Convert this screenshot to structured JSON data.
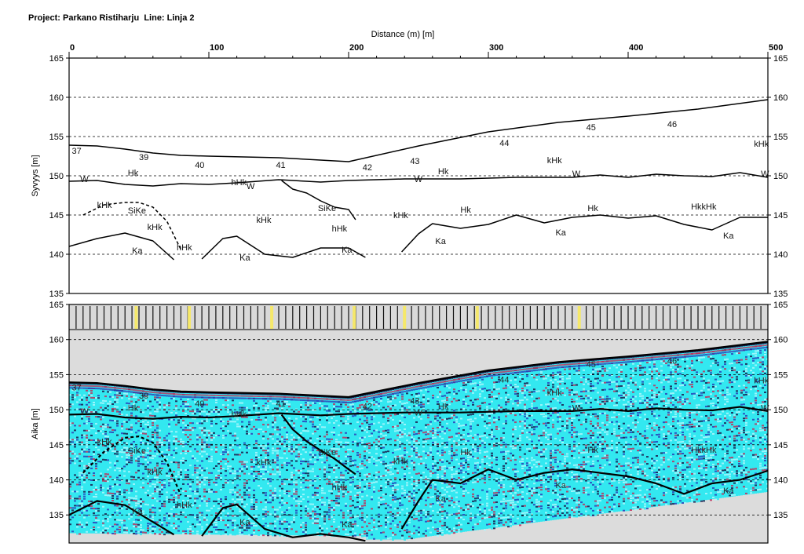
{
  "header": {
    "title": "Project: Parkano Ristiharju  Line: Linja 2"
  },
  "chart_data": [
    {
      "type": "line",
      "panel": "interpretation",
      "xlabel": "Distance (m) [m]",
      "ylabel": "Syvyys [m]",
      "xlim": [
        0,
        500
      ],
      "ylim": [
        135,
        165
      ],
      "x_ticks": [
        0,
        100,
        200,
        300,
        400,
        500
      ],
      "y_ticks": [
        135,
        140,
        145,
        150,
        155,
        160,
        165
      ],
      "grid": "horizontal dashed",
      "series": [
        {
          "role": "surface",
          "x": [
            0,
            20,
            40,
            60,
            80,
            100,
            150,
            200,
            250,
            300,
            350,
            400,
            450,
            500
          ],
          "values": [
            153.9,
            153.8,
            153.4,
            152.9,
            152.6,
            152.5,
            152.3,
            151.8,
            153.8,
            155.6,
            156.8,
            157.6,
            158.5,
            159.7
          ]
        },
        {
          "role": "water-table",
          "x": [
            0,
            20,
            40,
            60,
            80,
            100,
            120,
            150,
            180,
            200,
            240,
            280,
            320,
            360,
            380,
            400,
            420,
            440,
            460,
            480,
            500
          ],
          "values": [
            149.3,
            149.4,
            148.9,
            148.7,
            149.0,
            148.9,
            149.1,
            149.5,
            149.2,
            149.4,
            149.6,
            149.6,
            149.8,
            149.8,
            150.1,
            149.8,
            150.2,
            150.0,
            149.9,
            150.4,
            149.8
          ]
        },
        {
          "role": "bedrock-1",
          "x": [
            0,
            20,
            40,
            60,
            75
          ],
          "values": [
            141.0,
            142.0,
            142.7,
            141.7,
            139.3
          ]
        },
        {
          "role": "bedrock-2",
          "x": [
            95,
            110,
            120,
            140,
            160,
            180,
            200,
            212
          ],
          "values": [
            139.4,
            142.0,
            142.3,
            140.0,
            139.6,
            140.8,
            140.8,
            139.6
          ]
        },
        {
          "role": "bedrock-3",
          "x": [
            238,
            250,
            260,
            280,
            300,
            320,
            340,
            360,
            380,
            400,
            420,
            440,
            460,
            480,
            500
          ],
          "values": [
            140.3,
            142.6,
            143.9,
            143.3,
            143.8,
            145.0,
            144.0,
            144.7,
            145.0,
            144.6,
            144.9,
            143.8,
            143.1,
            144.7,
            144.7
          ]
        },
        {
          "role": "siltkey-1",
          "dashed": true,
          "x": [
            10,
            25,
            40,
            50,
            60,
            70,
            80
          ],
          "values": [
            145.0,
            146.3,
            146.6,
            146.6,
            146.0,
            144.2,
            140.6
          ]
        },
        {
          "role": "siltkey-2",
          "x": [
            152,
            160,
            170,
            180,
            190,
            200,
            205
          ],
          "values": [
            149.4,
            148.3,
            147.8,
            146.8,
            146.0,
            145.7,
            144.4
          ]
        }
      ],
      "annotations": [
        {
          "text": "37",
          "x": 2,
          "y": 153.2
        },
        {
          "text": "39",
          "x": 50,
          "y": 152.4
        },
        {
          "text": "40",
          "x": 90,
          "y": 151.4
        },
        {
          "text": "41",
          "x": 148,
          "y": 151.4
        },
        {
          "text": "42",
          "x": 210,
          "y": 151.1
        },
        {
          "text": "43",
          "x": 244,
          "y": 151.9
        },
        {
          "text": "44",
          "x": 308,
          "y": 154.2
        },
        {
          "text": "45",
          "x": 370,
          "y": 156.2
        },
        {
          "text": "46",
          "x": 428,
          "y": 156.6
        },
        {
          "text": "kHk",
          "x": 490,
          "y": 154.1
        },
        {
          "text": "W",
          "x": 8,
          "y": 149.6
        },
        {
          "text": "Hk",
          "x": 42,
          "y": 150.4
        },
        {
          "text": "hHk",
          "x": 116,
          "y": 149.2
        },
        {
          "text": "W",
          "x": 127,
          "y": 148.7
        },
        {
          "text": "W",
          "x": 247,
          "y": 149.6
        },
        {
          "text": "Hk",
          "x": 264,
          "y": 150.6
        },
        {
          "text": "kHk",
          "x": 342,
          "y": 152.0
        },
        {
          "text": "W",
          "x": 360,
          "y": 150.3
        },
        {
          "text": "W",
          "x": 495,
          "y": 150.3
        },
        {
          "text": "kHk",
          "x": 20,
          "y": 146.3
        },
        {
          "text": "SiKe",
          "x": 42,
          "y": 145.6
        },
        {
          "text": "kHk",
          "x": 56,
          "y": 143.5
        },
        {
          "text": "kHk",
          "x": 134,
          "y": 144.4
        },
        {
          "text": "SiKe",
          "x": 178,
          "y": 145.9
        },
        {
          "text": "hHk",
          "x": 188,
          "y": 143.3
        },
        {
          "text": "kHk",
          "x": 232,
          "y": 145.0
        },
        {
          "text": "Hk",
          "x": 280,
          "y": 145.7
        },
        {
          "text": "Hk",
          "x": 371,
          "y": 145.9
        },
        {
          "text": "HkkHk",
          "x": 445,
          "y": 146.1
        },
        {
          "text": "hHk",
          "x": 77,
          "y": 140.9
        },
        {
          "text": "Ka",
          "x": 45,
          "y": 140.5
        },
        {
          "text": "Ka",
          "x": 122,
          "y": 139.6
        },
        {
          "text": "Ka",
          "x": 195,
          "y": 140.6
        },
        {
          "text": "Ka",
          "x": 262,
          "y": 141.7
        },
        {
          "text": "Ka",
          "x": 348,
          "y": 142.8
        },
        {
          "text": "Ka",
          "x": 468,
          "y": 142.4
        }
      ]
    },
    {
      "type": "heatmap",
      "panel": "radargram",
      "ylabel": "Aika [m]",
      "xlim": [
        0,
        500
      ],
      "ylim": [
        131,
        165
      ],
      "y_ticks": [
        135,
        140,
        145,
        150,
        155,
        160,
        165
      ],
      "grid": "horizontal dashed",
      "marker_strip": {
        "interval_m": 5,
        "highlight_x": [
          48,
          86,
          145,
          204,
          240,
          292,
          365
        ]
      },
      "series": [
        {
          "role": "surface",
          "x": [
            0,
            20,
            40,
            60,
            80,
            100,
            150,
            200,
            250,
            300,
            350,
            400,
            450,
            500
          ],
          "values": [
            153.9,
            153.8,
            153.4,
            152.9,
            152.6,
            152.5,
            152.3,
            151.8,
            153.8,
            155.6,
            156.8,
            157.6,
            158.5,
            159.7
          ]
        },
        {
          "role": "water-table",
          "x": [
            0,
            20,
            40,
            60,
            80,
            100,
            120,
            150,
            180,
            200,
            240,
            280,
            320,
            360,
            380,
            400,
            420,
            440,
            460,
            480,
            500
          ],
          "values": [
            149.3,
            149.4,
            148.9,
            148.7,
            149.0,
            148.9,
            149.1,
            149.5,
            149.2,
            149.4,
            149.6,
            149.6,
            149.8,
            149.8,
            150.1,
            149.8,
            150.2,
            150.0,
            149.9,
            150.4,
            149.8
          ]
        },
        {
          "role": "bedrock-1",
          "x": [
            0,
            20,
            40,
            60,
            75
          ],
          "values": [
            135.0,
            137.0,
            136.4,
            134.0,
            132.2
          ]
        },
        {
          "role": "bedrock-2",
          "x": [
            95,
            110,
            120,
            140,
            160,
            180,
            200,
            212
          ],
          "values": [
            132.0,
            136.0,
            136.5,
            133.0,
            131.8,
            132.3,
            131.8,
            131.3
          ]
        },
        {
          "role": "bedrock-3",
          "x": [
            238,
            250,
            260,
            280,
            300,
            320,
            340,
            360,
            380,
            400,
            420,
            440,
            460,
            480,
            500
          ],
          "values": [
            133.0,
            137.0,
            140.0,
            139.5,
            141.5,
            140.0,
            141.0,
            141.5,
            141.0,
            140.5,
            139.5,
            138.0,
            139.5,
            140.0,
            141.3
          ]
        },
        {
          "role": "siltkey-1",
          "dashed": true,
          "x": [
            10,
            25,
            40,
            50,
            60,
            70,
            80
          ],
          "values": [
            141.0,
            144.0,
            146.0,
            146.2,
            145.3,
            142.5,
            137.8
          ]
        },
        {
          "role": "siltkey-2",
          "x": [
            152,
            160,
            170,
            180,
            190,
            200,
            205
          ],
          "values": [
            149.3,
            147.2,
            145.5,
            144.2,
            143.0,
            141.5,
            140.8
          ]
        }
      ],
      "annotations": [
        {
          "text": "37",
          "x": 2,
          "y": 153.2
        },
        {
          "text": "39",
          "x": 50,
          "y": 152.0
        },
        {
          "text": "40",
          "x": 90,
          "y": 150.9
        },
        {
          "text": "41",
          "x": 148,
          "y": 150.9
        },
        {
          "text": "42",
          "x": 210,
          "y": 150.5
        },
        {
          "text": "43",
          "x": 244,
          "y": 151.3
        },
        {
          "text": "44",
          "x": 308,
          "y": 154.3
        },
        {
          "text": "45",
          "x": 370,
          "y": 156.5
        },
        {
          "text": "46",
          "x": 428,
          "y": 157.0
        },
        {
          "text": "kHk",
          "x": 490,
          "y": 154.2
        },
        {
          "text": "W",
          "x": 8,
          "y": 149.8
        },
        {
          "text": "Hk",
          "x": 42,
          "y": 150.3
        },
        {
          "text": "hHk",
          "x": 116,
          "y": 149.4
        },
        {
          "text": "W",
          "x": 247,
          "y": 149.6
        },
        {
          "text": "Hk",
          "x": 264,
          "y": 150.5
        },
        {
          "text": "kHk",
          "x": 342,
          "y": 152.5
        },
        {
          "text": "W",
          "x": 360,
          "y": 150.3
        },
        {
          "text": "W",
          "x": 495,
          "y": 150.3
        },
        {
          "text": "kHk",
          "x": 20,
          "y": 145.5
        },
        {
          "text": "SiKe",
          "x": 42,
          "y": 144.2
        },
        {
          "text": "kHk",
          "x": 56,
          "y": 141.2
        },
        {
          "text": "kHk",
          "x": 134,
          "y": 142.5
        },
        {
          "text": "SiKe",
          "x": 178,
          "y": 144.0
        },
        {
          "text": "hHk",
          "x": 188,
          "y": 139.0
        },
        {
          "text": "kHk",
          "x": 232,
          "y": 142.7
        },
        {
          "text": "Hk",
          "x": 280,
          "y": 144.0
        },
        {
          "text": "Hk",
          "x": 371,
          "y": 144.3
        },
        {
          "text": "HkkHk",
          "x": 445,
          "y": 144.3
        },
        {
          "text": "hHk",
          "x": 77,
          "y": 136.5
        },
        {
          "text": "Ka",
          "x": 45,
          "y": 135.6
        },
        {
          "text": "Ka",
          "x": 122,
          "y": 134.0
        },
        {
          "text": "Ka",
          "x": 195,
          "y": 133.7
        },
        {
          "text": "Ka",
          "x": 262,
          "y": 137.4
        },
        {
          "text": "Ka",
          "x": 348,
          "y": 139.3
        },
        {
          "text": "Ka",
          "x": 468,
          "y": 138.5
        }
      ]
    }
  ],
  "colors": {
    "frame": "#000000",
    "gridline": "#000000",
    "interpretation_line": "#000000",
    "radar_background": "#dcdcdc",
    "radar_cyan": "#33e8f0",
    "radar_light": "#aef6fb",
    "radar_red": "#c0305a",
    "radar_blue": "#2a3fb8",
    "radar_dark": "#1a1a4a",
    "marker_strip_bg": "#d9d9d9",
    "marker_highlight": "#f5e86a"
  }
}
